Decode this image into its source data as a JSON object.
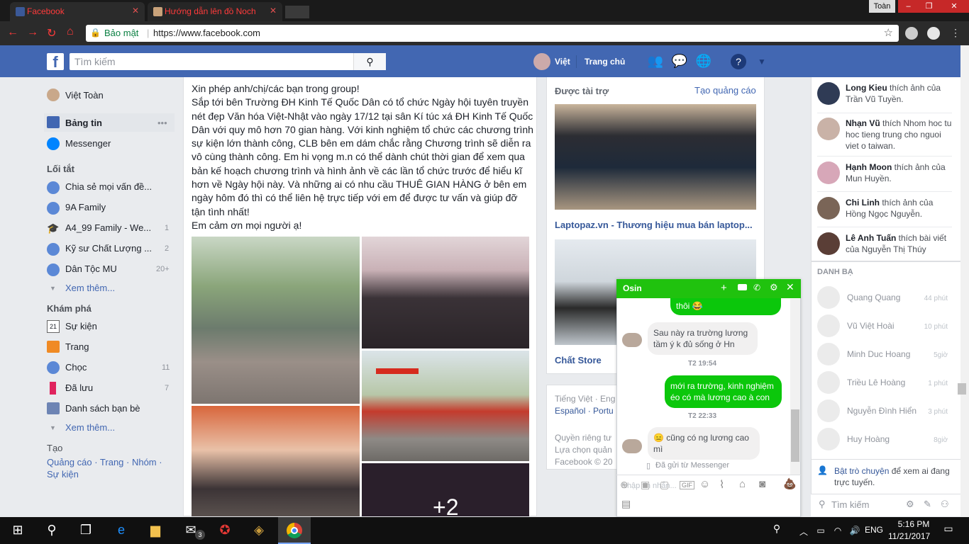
{
  "browser": {
    "tabs": [
      {
        "title": "Facebook"
      },
      {
        "title": "Hướng dẫn lên đồ Noch"
      }
    ],
    "profile": "Toàn",
    "security_label": "Bảo mật",
    "url": "https://www.facebook.com"
  },
  "header": {
    "search_placeholder": "Tìm kiếm",
    "user_name": "Việt",
    "home_label": "Trang chủ"
  },
  "left_nav": {
    "user": "Việt Toàn",
    "main": [
      {
        "label": "Bảng tin",
        "more": "•••"
      },
      {
        "label": "Messenger"
      }
    ],
    "shortcuts_title": "Lối tắt",
    "shortcuts": [
      {
        "label": "Chia sẻ mọi vấn đề...",
        "count": ""
      },
      {
        "label": "9A Family",
        "count": ""
      },
      {
        "label": "A4_99 Family - We...",
        "count": "1"
      },
      {
        "label": "Kỹ sư Chất Lượng ...",
        "count": "2"
      },
      {
        "label": "Dân Tộc MU",
        "count": "20+"
      }
    ],
    "see_more": "Xem thêm...",
    "explore_title": "Khám phá",
    "explore": [
      {
        "label": "Sự kiện",
        "count": ""
      },
      {
        "label": "Trang",
        "count": ""
      },
      {
        "label": "Chọc",
        "count": "11"
      },
      {
        "label": "Đã lưu",
        "count": "7"
      },
      {
        "label": "Danh sách bạn bè",
        "count": ""
      }
    ],
    "see_more2": "Xem thêm...",
    "create_title": "Tạo",
    "create_links": "Quảng cáo · Trang · Nhóm ·",
    "create_links2": "Sự kiện"
  },
  "post": {
    "text": "Xin phép anh/chị/các bạn trong group!\nSắp tới bên Trường ĐH Kinh Tế Quốc Dân có tổ chức Ngày hội tuyên truyền nét đẹp Văn hóa Việt-Nhật vào ngày 17/12 tại sân Kí túc xá ĐH Kinh Tế Quốc Dân với quy mô hơn 70 gian hàng. Với kinh nghiệm tổ chức các chương trình sự kiện lớn thành công, CLB bên em dám chắc rằng Chương trình sẽ diễn ra vô cùng thành công. Em hi vọng m.n có thể dành chút thời gian để xem qua bản kế hoạch chương trình và hình ảnh về các lần tổ chức trước để hiểu kĩ hơn về Ngày hội này. Và những ai có nhu cầu THUÊ GIAN HÀNG ở bên em ngày hôm đó thì có thể liên hệ trực tiếp với em để được tư vấn và giúp đỡ tận tình nhất!\nEm cảm ơn mọi người ạ!",
    "photo_overlay": "+2"
  },
  "sponsored": {
    "title": "Được tài trợ",
    "create_ad": "Tạo quảng cáo",
    "ad1": "Laptopaz.vn - Thương hiệu mua bán laptop...",
    "ad2": "Chất Store"
  },
  "footer": {
    "langs1": "Tiếng Việt · Eng",
    "langs2": "Español · Portu",
    "links1": "Quyền riêng tư",
    "links2": "Lựa chọn quản",
    "copy": "Facebook © 20"
  },
  "ticker": [
    {
      "name": "Long Kieu",
      "text": " thích ảnh của Trần Vũ Tuyền."
    },
    {
      "name": "Nhạn Vũ",
      "text": " thích Nhom hoc tu hoc tieng trung cho nguoi viet o taiwan."
    },
    {
      "name": "Hạnh Moon",
      "text": " thích ảnh của Mun Huyền."
    },
    {
      "name": "Chi Linh",
      "text": " thích ảnh của Hồng Ngọc Nguyễn."
    },
    {
      "name": "Lê Anh Tuấn",
      "text": " thích bài viết của Nguyễn Thị Thúy"
    }
  ],
  "friends_title": "DANH BẠ",
  "friends": [
    {
      "name": "Quang Quang",
      "time": "44 phút"
    },
    {
      "name": "Vũ Việt Hoài",
      "time": "10 phút"
    },
    {
      "name": "Minh Duc Hoang",
      "time": "5giờ"
    },
    {
      "name": "Triều Lê Hoàng",
      "time": "1 phút"
    },
    {
      "name": "Nguyễn Đình Hiển",
      "time": "3 phút"
    },
    {
      "name": "Huy Hoàng",
      "time": "8giờ"
    }
  ],
  "turn_on_chat": "Bật trò chuyện",
  "turn_on_chat_rest": " để xem ai đang trực tuyến.",
  "friend_search_placeholder": "Tìm kiếm",
  "chat": {
    "name": "Osin",
    "m1": "thôi 😂",
    "m2": "Sau này ra trường lương tầm ý k đủ sống ở Hn",
    "t1": "T2 19:54",
    "m3": "mới ra trường, kinh nghiệm éo có mà lương cao à con",
    "t2": "T2 22:33",
    "m4": "😑 cũng có ng lương cao mì",
    "sent": "Đã gửi từ Messenger",
    "input_placeholder": "Nhập tin nhắn..."
  },
  "taskbar": {
    "lang": "ENG",
    "time": "5:16 PM",
    "date": "11/21/2017",
    "badge": "3"
  },
  "colors": {
    "fb_blue": "#4267b2",
    "chat_green": "#20c20e"
  }
}
